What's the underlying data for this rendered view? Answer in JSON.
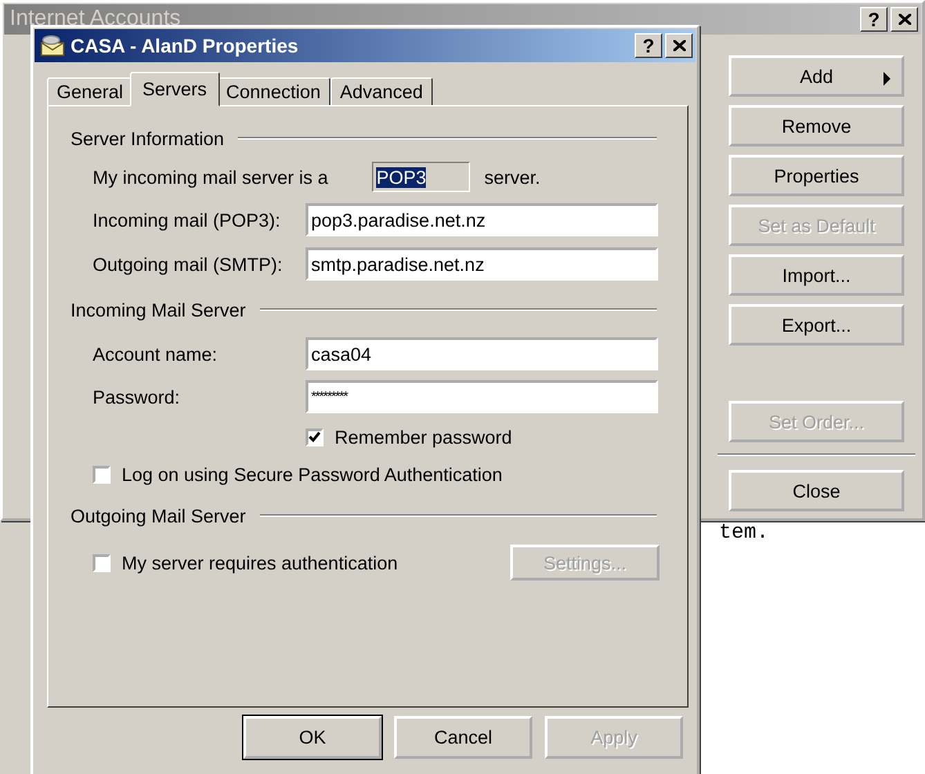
{
  "background_window": {
    "title": "Internet Accounts",
    "help_button": "?",
    "buttons": [
      {
        "label": "Add",
        "kind": "menu",
        "disabled": false
      },
      {
        "label": "Remove",
        "kind": "push",
        "disabled": false
      },
      {
        "label": "Properties",
        "kind": "push",
        "disabled": false
      },
      {
        "label": "Set as Default",
        "kind": "push",
        "disabled": true
      },
      {
        "label": "Import...",
        "kind": "push",
        "disabled": false
      },
      {
        "label": "Export...",
        "kind": "push",
        "disabled": false
      },
      {
        "label": "Set Order...",
        "kind": "push",
        "disabled": true
      },
      {
        "label": "Close",
        "kind": "push",
        "disabled": false
      }
    ]
  },
  "background_text": "tem.",
  "dialog": {
    "title": "CASA - AlanD Properties",
    "help_button": "?",
    "tabs": [
      {
        "label": "General",
        "selected": false
      },
      {
        "label": "Servers",
        "selected": true
      },
      {
        "label": "Connection",
        "selected": false
      },
      {
        "label": "Advanced",
        "selected": false
      }
    ],
    "server_information": {
      "title": "Server Information",
      "server_type_label": "My incoming mail server is a",
      "server_type_value": "POP3",
      "server_type_suffix": "server.",
      "incoming_label": "Incoming mail (POP3):",
      "incoming_value": "pop3.paradise.net.nz",
      "outgoing_label": "Outgoing mail (SMTP):",
      "outgoing_value": "smtp.paradise.net.nz"
    },
    "incoming_mail_server": {
      "title": "Incoming Mail Server",
      "account_label": "Account name:",
      "account_value": "casa04",
      "password_label": "Password:",
      "password_value": "*********",
      "remember_password": {
        "label": "Remember password",
        "checked": true
      },
      "secure_password_auth": {
        "label": "Log on using Secure Password Authentication",
        "checked": false
      }
    },
    "outgoing_mail_server": {
      "title": "Outgoing Mail Server",
      "requires_auth": {
        "label": "My server requires authentication",
        "checked": false
      },
      "settings_button": {
        "label": "Settings...",
        "disabled": true
      }
    },
    "buttons": [
      {
        "label": "OK",
        "default": true,
        "disabled": false
      },
      {
        "label": "Cancel",
        "default": false,
        "disabled": false
      },
      {
        "label": "Apply",
        "default": false,
        "disabled": true
      }
    ]
  }
}
